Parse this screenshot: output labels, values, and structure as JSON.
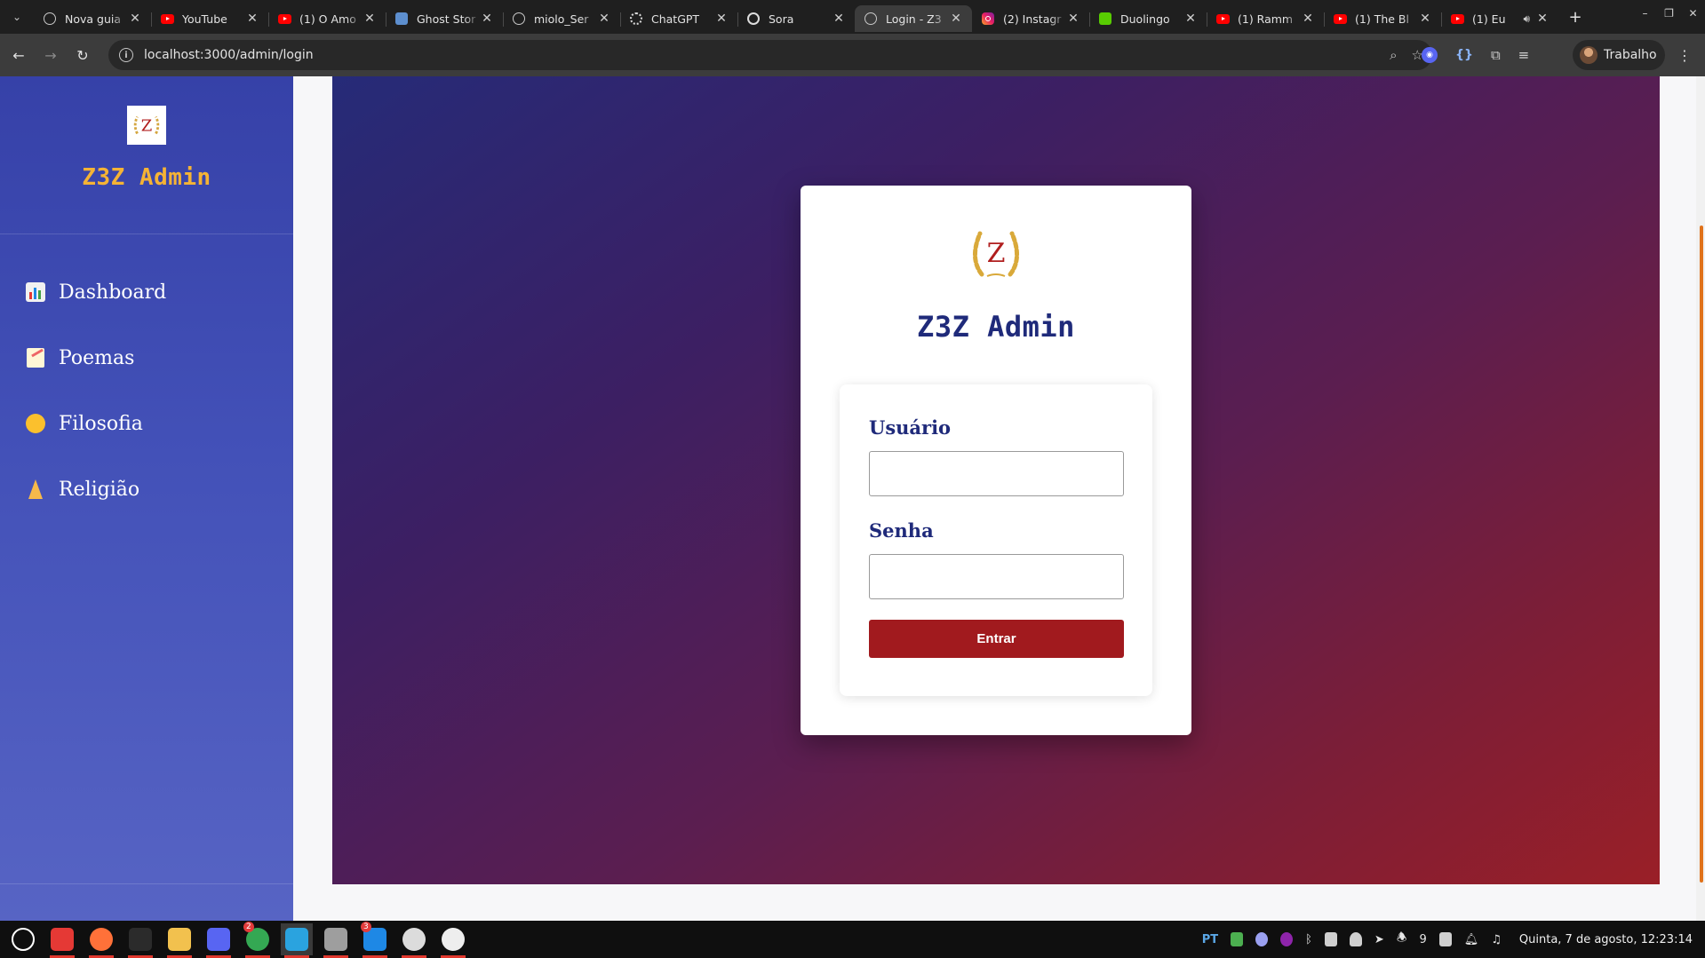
{
  "browser": {
    "tabs": [
      {
        "title": "Nova guia",
        "icon": "globe"
      },
      {
        "title": "YouTube",
        "icon": "youtube"
      },
      {
        "title": "(1) O Amo",
        "icon": "youtube"
      },
      {
        "title": "Ghost Stor",
        "icon": "ghost"
      },
      {
        "title": "miolo_Ser",
        "icon": "globe"
      },
      {
        "title": "ChatGPT",
        "icon": "chatgpt"
      },
      {
        "title": "Sora",
        "icon": "sora"
      },
      {
        "title": "Login - Z3",
        "icon": "globe",
        "active": true
      },
      {
        "title": "(2) Instagr",
        "icon": "instagram"
      },
      {
        "title": "Duolingo",
        "icon": "duolingo"
      },
      {
        "title": "(1) Ramm",
        "icon": "youtube"
      },
      {
        "title": "(1) The Bl",
        "icon": "youtube"
      },
      {
        "title": "(1) Eu",
        "icon": "youtube",
        "audio": true
      }
    ],
    "url": "localhost:3000/admin/login",
    "profile_name": "Trabalho"
  },
  "sidebar": {
    "title": "Z3Z Admin",
    "logo_letter": "Z",
    "items": [
      {
        "label": "Dashboard",
        "icon": "bar-chart-emoji"
      },
      {
        "label": "Poemas",
        "icon": "memo-emoji"
      },
      {
        "label": "Filosofia",
        "icon": "thinking-face-emoji"
      },
      {
        "label": "Religião",
        "icon": "praying-hands-emoji"
      }
    ]
  },
  "login": {
    "title": "Z3Z Admin",
    "logo_letter": "Z",
    "username_label": "Usuário",
    "username_value": "",
    "password_label": "Senha",
    "password_value": "",
    "submit_label": "Entrar"
  },
  "taskbar": {
    "apps": [
      {
        "name": "menu",
        "color": "#ffffff"
      },
      {
        "name": "files",
        "color": "#e53935",
        "running": true
      },
      {
        "name": "firefox",
        "color": "#ff7139",
        "running": true
      },
      {
        "name": "terminal",
        "color": "#2b2b2b",
        "running": true
      },
      {
        "name": "claws",
        "color": "#f2c14e",
        "running": true
      },
      {
        "name": "discord",
        "color": "#5865f2",
        "running": true
      },
      {
        "name": "chrome",
        "color": "#34a853",
        "running": true,
        "badge": "2"
      },
      {
        "name": "telegram",
        "color": "#2aa3df",
        "running": true,
        "focused": true
      },
      {
        "name": "sound",
        "color": "#9e9e9e",
        "running": true
      },
      {
        "name": "vscode",
        "color": "#1e88e5",
        "running": true,
        "badge": "3"
      },
      {
        "name": "obs",
        "color": "#dcdcdc",
        "running": true
      },
      {
        "name": "inkscape",
        "color": "#eeeeee",
        "running": true
      }
    ],
    "language": "PT",
    "tray_count": "9",
    "clock": "Quinta, 7 de agosto, 12:23:14"
  },
  "colors": {
    "sidebar_title": "#f5b335",
    "card_title": "#1f2a7a",
    "button": "#a11a1e",
    "hero_start": "#262b78",
    "hero_end": "#9a1f27"
  }
}
